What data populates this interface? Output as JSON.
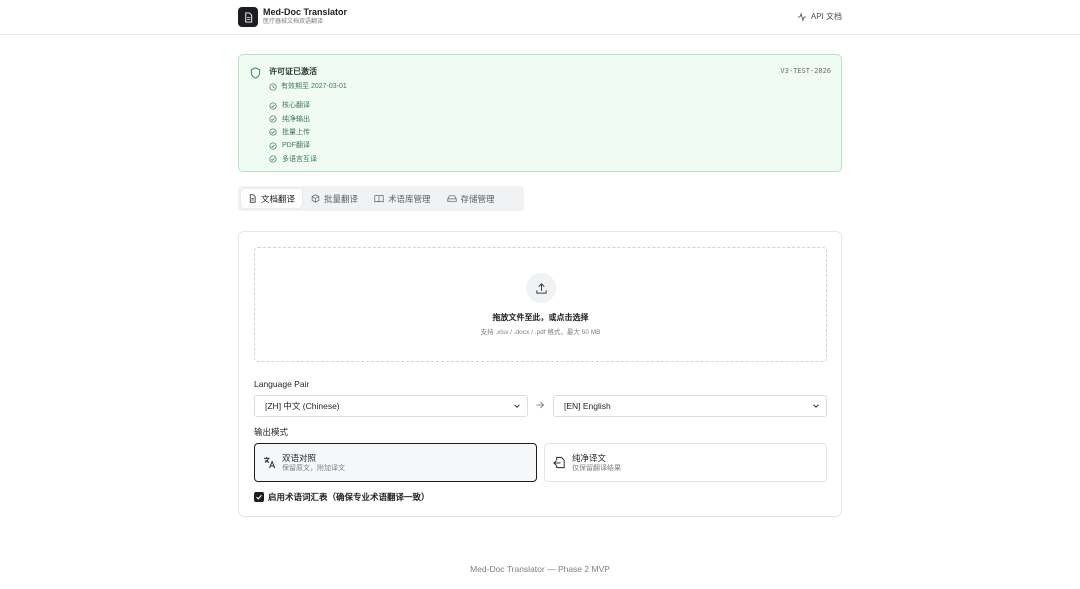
{
  "header": {
    "app_title": "Med-Doc Translator",
    "app_subtitle": "医疗器械文档双语翻译",
    "api_link": "API 文档"
  },
  "license": {
    "title": "许可证已激活",
    "code": "V3-TEST-2026",
    "expiry": "有效期至 2027-03-01",
    "features": [
      "核心翻译",
      "纯净输出",
      "批量上传",
      "PDF翻译",
      "多语言互译"
    ]
  },
  "tabs": [
    {
      "label": "文档翻译",
      "icon": "document-icon",
      "active": true
    },
    {
      "label": "批量翻译",
      "icon": "package-icon",
      "active": false
    },
    {
      "label": "术语库管理",
      "icon": "book-icon",
      "active": false
    },
    {
      "label": "存储管理",
      "icon": "drive-icon",
      "active": false
    }
  ],
  "upload": {
    "title": "拖放文件至此，或点击选择",
    "hint": "支持 .xlsx / .docx / .pdf 格式，最大 50 MB"
  },
  "language": {
    "label": "Language Pair",
    "source": "[ZH] 中文 (Chinese)",
    "target": "[EN] English"
  },
  "output_mode": {
    "label": "输出模式",
    "options": [
      {
        "title": "双语对照",
        "desc": "保留原文，附加译文",
        "selected": true
      },
      {
        "title": "纯净译文",
        "desc": "仅保留翻译结果",
        "selected": false
      }
    ]
  },
  "glossary": {
    "label": "启用术语词汇表（确保专业术语翻译一致）",
    "checked": true
  },
  "footer": {
    "text": "Med-Doc Translator — Phase 2 MVP"
  },
  "colors": {
    "accent": "#1b1d20",
    "success_bg": "#f0fbf3",
    "success_border": "#b7e4c4",
    "success_text": "#3d7a53"
  }
}
